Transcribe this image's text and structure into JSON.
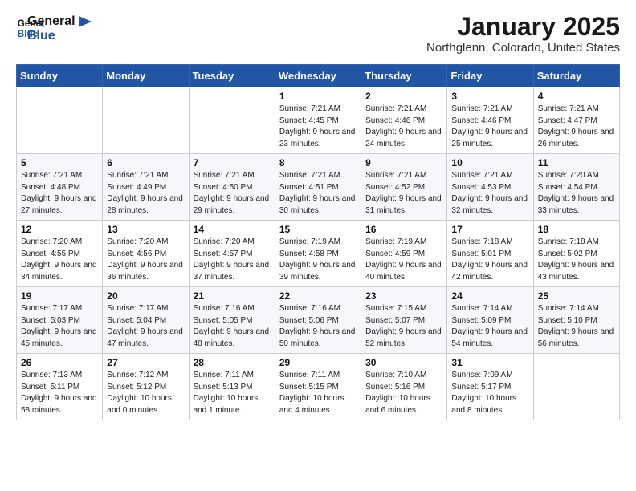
{
  "logo": {
    "line1": "General",
    "line2": "Blue"
  },
  "title": "January 2025",
  "subtitle": "Northglenn, Colorado, United States",
  "days_of_week": [
    "Sunday",
    "Monday",
    "Tuesday",
    "Wednesday",
    "Thursday",
    "Friday",
    "Saturday"
  ],
  "weeks": [
    [
      {
        "day": "",
        "sunrise": "",
        "sunset": "",
        "daylight": ""
      },
      {
        "day": "",
        "sunrise": "",
        "sunset": "",
        "daylight": ""
      },
      {
        "day": "",
        "sunrise": "",
        "sunset": "",
        "daylight": ""
      },
      {
        "day": "1",
        "sunrise": "Sunrise: 7:21 AM",
        "sunset": "Sunset: 4:45 PM",
        "daylight": "Daylight: 9 hours and 23 minutes."
      },
      {
        "day": "2",
        "sunrise": "Sunrise: 7:21 AM",
        "sunset": "Sunset: 4:46 PM",
        "daylight": "Daylight: 9 hours and 24 minutes."
      },
      {
        "day": "3",
        "sunrise": "Sunrise: 7:21 AM",
        "sunset": "Sunset: 4:46 PM",
        "daylight": "Daylight: 9 hours and 25 minutes."
      },
      {
        "day": "4",
        "sunrise": "Sunrise: 7:21 AM",
        "sunset": "Sunset: 4:47 PM",
        "daylight": "Daylight: 9 hours and 26 minutes."
      }
    ],
    [
      {
        "day": "5",
        "sunrise": "Sunrise: 7:21 AM",
        "sunset": "Sunset: 4:48 PM",
        "daylight": "Daylight: 9 hours and 27 minutes."
      },
      {
        "day": "6",
        "sunrise": "Sunrise: 7:21 AM",
        "sunset": "Sunset: 4:49 PM",
        "daylight": "Daylight: 9 hours and 28 minutes."
      },
      {
        "day": "7",
        "sunrise": "Sunrise: 7:21 AM",
        "sunset": "Sunset: 4:50 PM",
        "daylight": "Daylight: 9 hours and 29 minutes."
      },
      {
        "day": "8",
        "sunrise": "Sunrise: 7:21 AM",
        "sunset": "Sunset: 4:51 PM",
        "daylight": "Daylight: 9 hours and 30 minutes."
      },
      {
        "day": "9",
        "sunrise": "Sunrise: 7:21 AM",
        "sunset": "Sunset: 4:52 PM",
        "daylight": "Daylight: 9 hours and 31 minutes."
      },
      {
        "day": "10",
        "sunrise": "Sunrise: 7:21 AM",
        "sunset": "Sunset: 4:53 PM",
        "daylight": "Daylight: 9 hours and 32 minutes."
      },
      {
        "day": "11",
        "sunrise": "Sunrise: 7:20 AM",
        "sunset": "Sunset: 4:54 PM",
        "daylight": "Daylight: 9 hours and 33 minutes."
      }
    ],
    [
      {
        "day": "12",
        "sunrise": "Sunrise: 7:20 AM",
        "sunset": "Sunset: 4:55 PM",
        "daylight": "Daylight: 9 hours and 34 minutes."
      },
      {
        "day": "13",
        "sunrise": "Sunrise: 7:20 AM",
        "sunset": "Sunset: 4:56 PM",
        "daylight": "Daylight: 9 hours and 36 minutes."
      },
      {
        "day": "14",
        "sunrise": "Sunrise: 7:20 AM",
        "sunset": "Sunset: 4:57 PM",
        "daylight": "Daylight: 9 hours and 37 minutes."
      },
      {
        "day": "15",
        "sunrise": "Sunrise: 7:19 AM",
        "sunset": "Sunset: 4:58 PM",
        "daylight": "Daylight: 9 hours and 39 minutes."
      },
      {
        "day": "16",
        "sunrise": "Sunrise: 7:19 AM",
        "sunset": "Sunset: 4:59 PM",
        "daylight": "Daylight: 9 hours and 40 minutes."
      },
      {
        "day": "17",
        "sunrise": "Sunrise: 7:18 AM",
        "sunset": "Sunset: 5:01 PM",
        "daylight": "Daylight: 9 hours and 42 minutes."
      },
      {
        "day": "18",
        "sunrise": "Sunrise: 7:18 AM",
        "sunset": "Sunset: 5:02 PM",
        "daylight": "Daylight: 9 hours and 43 minutes."
      }
    ],
    [
      {
        "day": "19",
        "sunrise": "Sunrise: 7:17 AM",
        "sunset": "Sunset: 5:03 PM",
        "daylight": "Daylight: 9 hours and 45 minutes."
      },
      {
        "day": "20",
        "sunrise": "Sunrise: 7:17 AM",
        "sunset": "Sunset: 5:04 PM",
        "daylight": "Daylight: 9 hours and 47 minutes."
      },
      {
        "day": "21",
        "sunrise": "Sunrise: 7:16 AM",
        "sunset": "Sunset: 5:05 PM",
        "daylight": "Daylight: 9 hours and 48 minutes."
      },
      {
        "day": "22",
        "sunrise": "Sunrise: 7:16 AM",
        "sunset": "Sunset: 5:06 PM",
        "daylight": "Daylight: 9 hours and 50 minutes."
      },
      {
        "day": "23",
        "sunrise": "Sunrise: 7:15 AM",
        "sunset": "Sunset: 5:07 PM",
        "daylight": "Daylight: 9 hours and 52 minutes."
      },
      {
        "day": "24",
        "sunrise": "Sunrise: 7:14 AM",
        "sunset": "Sunset: 5:09 PM",
        "daylight": "Daylight: 9 hours and 54 minutes."
      },
      {
        "day": "25",
        "sunrise": "Sunrise: 7:14 AM",
        "sunset": "Sunset: 5:10 PM",
        "daylight": "Daylight: 9 hours and 56 minutes."
      }
    ],
    [
      {
        "day": "26",
        "sunrise": "Sunrise: 7:13 AM",
        "sunset": "Sunset: 5:11 PM",
        "daylight": "Daylight: 9 hours and 58 minutes."
      },
      {
        "day": "27",
        "sunrise": "Sunrise: 7:12 AM",
        "sunset": "Sunset: 5:12 PM",
        "daylight": "Daylight: 10 hours and 0 minutes."
      },
      {
        "day": "28",
        "sunrise": "Sunrise: 7:11 AM",
        "sunset": "Sunset: 5:13 PM",
        "daylight": "Daylight: 10 hours and 1 minute."
      },
      {
        "day": "29",
        "sunrise": "Sunrise: 7:11 AM",
        "sunset": "Sunset: 5:15 PM",
        "daylight": "Daylight: 10 hours and 4 minutes."
      },
      {
        "day": "30",
        "sunrise": "Sunrise: 7:10 AM",
        "sunset": "Sunset: 5:16 PM",
        "daylight": "Daylight: 10 hours and 6 minutes."
      },
      {
        "day": "31",
        "sunrise": "Sunrise: 7:09 AM",
        "sunset": "Sunset: 5:17 PM",
        "daylight": "Daylight: 10 hours and 8 minutes."
      },
      {
        "day": "",
        "sunrise": "",
        "sunset": "",
        "daylight": ""
      }
    ]
  ]
}
